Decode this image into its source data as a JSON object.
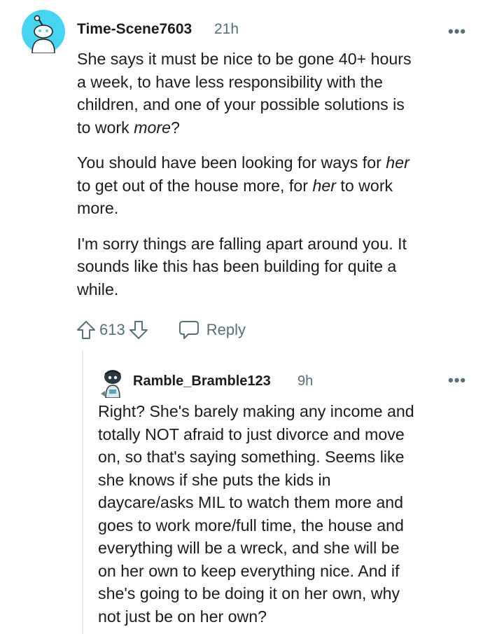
{
  "comment": {
    "username": "Time-Scene7603",
    "time": "21h",
    "more": "•••",
    "paragraphs": [
      [
        "She says it must be nice to be gone 40+ hours",
        "a week, to have less responsibility with the",
        "children, and one of your possible solutions is",
        "to work ",
        "more",
        "?"
      ],
      [
        "You should have been looking for ways for ",
        "her",
        "to get out of the house more, for ",
        "her",
        " to work",
        "more."
      ],
      [
        "I'm sorry things are falling apart around you. It",
        "sounds like this has been building for quite a",
        "while."
      ]
    ],
    "votes": "613",
    "reply_label": "Reply"
  },
  "reply": {
    "username": "Ramble_Bramble123",
    "time": "9h",
    "more": "•••",
    "lines": [
      "Right? She's barely making any income and",
      "totally NOT afraid to just divorce and move",
      "on, so that's saying something. Seems like",
      "she knows if she puts the kids in",
      "daycare/asks MIL to watch them more and",
      "goes to work more/full time, the house and",
      "everything will be a wreck, and she will be",
      "on her own to keep everything nice. And if",
      "she's going to be doing it on her own, why",
      "not just be on her own?"
    ]
  },
  "colors": {
    "avatar_bg": "#46d5f0",
    "text": "#1c1c1c",
    "meta": "#576f76",
    "thread": "#e5ebee"
  },
  "icons": [
    "snoo-avatar-icon",
    "upvote-icon",
    "downvote-icon",
    "reply-bubble-icon",
    "more-options-icon",
    "user-avatar-icon"
  ]
}
